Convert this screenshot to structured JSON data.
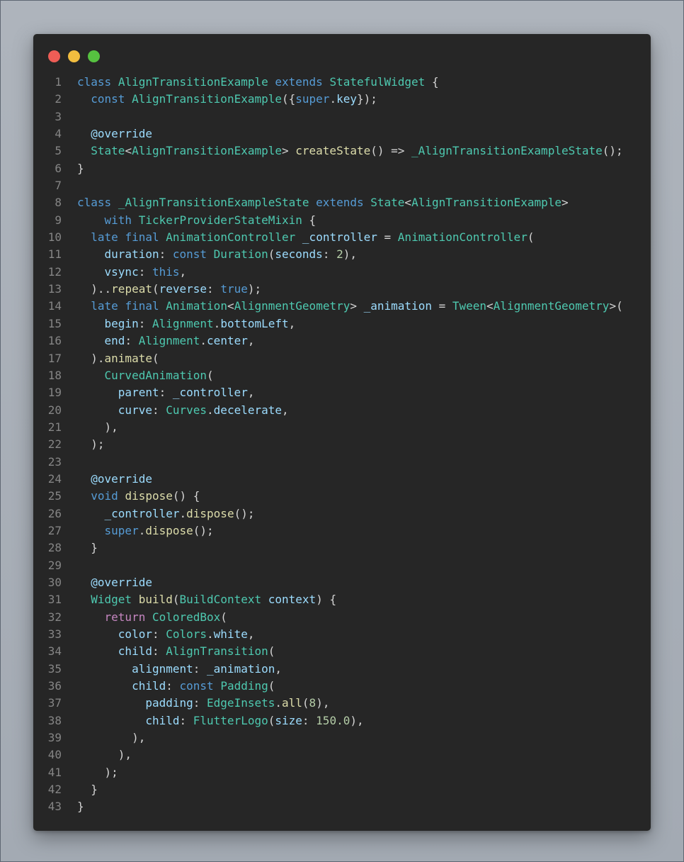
{
  "window": {
    "traffic_lights": [
      {
        "name": "close",
        "color": "#ee5d56"
      },
      {
        "name": "minimize",
        "color": "#f2bd3f"
      },
      {
        "name": "zoom",
        "color": "#56c140"
      }
    ]
  },
  "theme": {
    "background": "#262626",
    "line_number_color": "#858585",
    "keyword": "#569cd6",
    "control": "#c586c0",
    "type": "#4ec9b0",
    "function": "#dcdcaa",
    "variable": "#9cdcfe",
    "number": "#b5cea8",
    "plain": "#d4d4d4"
  },
  "code": {
    "language": "dart",
    "lines": [
      {
        "n": "1",
        "tokens": [
          [
            "kw",
            "class"
          ],
          [
            "pl",
            " "
          ],
          [
            "type",
            "AlignTransitionExample"
          ],
          [
            "pl",
            " "
          ],
          [
            "kw",
            "extends"
          ],
          [
            "pl",
            " "
          ],
          [
            "type",
            "StatefulWidget"
          ],
          [
            "pl",
            " {"
          ]
        ]
      },
      {
        "n": "2",
        "tokens": [
          [
            "pl",
            "  "
          ],
          [
            "kw",
            "const"
          ],
          [
            "pl",
            " "
          ],
          [
            "type",
            "AlignTransitionExample"
          ],
          [
            "pl",
            "({"
          ],
          [
            "kw",
            "super"
          ],
          [
            "pl",
            "."
          ],
          [
            "var",
            "key"
          ],
          [
            "pl",
            "});"
          ]
        ]
      },
      {
        "n": "3",
        "tokens": []
      },
      {
        "n": "4",
        "tokens": [
          [
            "pl",
            "  "
          ],
          [
            "an",
            "@override"
          ]
        ]
      },
      {
        "n": "5",
        "tokens": [
          [
            "pl",
            "  "
          ],
          [
            "type",
            "State"
          ],
          [
            "pl",
            "<"
          ],
          [
            "type",
            "AlignTransitionExample"
          ],
          [
            "pl",
            "> "
          ],
          [
            "fn",
            "createState"
          ],
          [
            "pl",
            "() => "
          ],
          [
            "type",
            "_AlignTransitionExampleState"
          ],
          [
            "pl",
            "();"
          ]
        ]
      },
      {
        "n": "6",
        "tokens": [
          [
            "pl",
            "}"
          ]
        ]
      },
      {
        "n": "7",
        "tokens": []
      },
      {
        "n": "8",
        "tokens": [
          [
            "kw",
            "class"
          ],
          [
            "pl",
            " "
          ],
          [
            "type",
            "_AlignTransitionExampleState"
          ],
          [
            "pl",
            " "
          ],
          [
            "kw",
            "extends"
          ],
          [
            "pl",
            " "
          ],
          [
            "type",
            "State"
          ],
          [
            "pl",
            "<"
          ],
          [
            "type",
            "AlignTransitionExample"
          ],
          [
            "pl",
            ">"
          ]
        ]
      },
      {
        "n": "9",
        "tokens": [
          [
            "pl",
            "    "
          ],
          [
            "kw",
            "with"
          ],
          [
            "pl",
            " "
          ],
          [
            "type",
            "TickerProviderStateMixin"
          ],
          [
            "pl",
            " {"
          ]
        ]
      },
      {
        "n": "10",
        "tokens": [
          [
            "pl",
            "  "
          ],
          [
            "kw",
            "late"
          ],
          [
            "pl",
            " "
          ],
          [
            "kw",
            "final"
          ],
          [
            "pl",
            " "
          ],
          [
            "type",
            "AnimationController"
          ],
          [
            "pl",
            " "
          ],
          [
            "var",
            "_controller"
          ],
          [
            "pl",
            " = "
          ],
          [
            "type",
            "AnimationController"
          ],
          [
            "pl",
            "("
          ]
        ]
      },
      {
        "n": "11",
        "tokens": [
          [
            "pl",
            "    "
          ],
          [
            "var",
            "duration"
          ],
          [
            "pl",
            ": "
          ],
          [
            "kw",
            "const"
          ],
          [
            "pl",
            " "
          ],
          [
            "type",
            "Duration"
          ],
          [
            "pl",
            "("
          ],
          [
            "var",
            "seconds"
          ],
          [
            "pl",
            ": "
          ],
          [
            "num",
            "2"
          ],
          [
            "pl",
            "),"
          ]
        ]
      },
      {
        "n": "12",
        "tokens": [
          [
            "pl",
            "    "
          ],
          [
            "var",
            "vsync"
          ],
          [
            "pl",
            ": "
          ],
          [
            "kw",
            "this"
          ],
          [
            "pl",
            ","
          ]
        ]
      },
      {
        "n": "13",
        "tokens": [
          [
            "pl",
            "  ).."
          ],
          [
            "fn",
            "repeat"
          ],
          [
            "pl",
            "("
          ],
          [
            "var",
            "reverse"
          ],
          [
            "pl",
            ": "
          ],
          [
            "kw",
            "true"
          ],
          [
            "pl",
            ");"
          ]
        ]
      },
      {
        "n": "14",
        "tokens": [
          [
            "pl",
            "  "
          ],
          [
            "kw",
            "late"
          ],
          [
            "pl",
            " "
          ],
          [
            "kw",
            "final"
          ],
          [
            "pl",
            " "
          ],
          [
            "type",
            "Animation"
          ],
          [
            "pl",
            "<"
          ],
          [
            "type",
            "AlignmentGeometry"
          ],
          [
            "pl",
            "> "
          ],
          [
            "var",
            "_animation"
          ],
          [
            "pl",
            " = "
          ],
          [
            "type",
            "Tween"
          ],
          [
            "pl",
            "<"
          ],
          [
            "type",
            "AlignmentGeometry"
          ],
          [
            "pl",
            ">("
          ]
        ]
      },
      {
        "n": "15",
        "tokens": [
          [
            "pl",
            "    "
          ],
          [
            "var",
            "begin"
          ],
          [
            "pl",
            ": "
          ],
          [
            "type",
            "Alignment"
          ],
          [
            "pl",
            "."
          ],
          [
            "var",
            "bottomLeft"
          ],
          [
            "pl",
            ","
          ]
        ]
      },
      {
        "n": "16",
        "tokens": [
          [
            "pl",
            "    "
          ],
          [
            "var",
            "end"
          ],
          [
            "pl",
            ": "
          ],
          [
            "type",
            "Alignment"
          ],
          [
            "pl",
            "."
          ],
          [
            "var",
            "center"
          ],
          [
            "pl",
            ","
          ]
        ]
      },
      {
        "n": "17",
        "tokens": [
          [
            "pl",
            "  )."
          ],
          [
            "fn",
            "animate"
          ],
          [
            "pl",
            "("
          ]
        ]
      },
      {
        "n": "18",
        "tokens": [
          [
            "pl",
            "    "
          ],
          [
            "type",
            "CurvedAnimation"
          ],
          [
            "pl",
            "("
          ]
        ]
      },
      {
        "n": "19",
        "tokens": [
          [
            "pl",
            "      "
          ],
          [
            "var",
            "parent"
          ],
          [
            "pl",
            ": "
          ],
          [
            "var",
            "_controller"
          ],
          [
            "pl",
            ","
          ]
        ]
      },
      {
        "n": "20",
        "tokens": [
          [
            "pl",
            "      "
          ],
          [
            "var",
            "curve"
          ],
          [
            "pl",
            ": "
          ],
          [
            "type",
            "Curves"
          ],
          [
            "pl",
            "."
          ],
          [
            "var",
            "decelerate"
          ],
          [
            "pl",
            ","
          ]
        ]
      },
      {
        "n": "21",
        "tokens": [
          [
            "pl",
            "    ),"
          ]
        ]
      },
      {
        "n": "22",
        "tokens": [
          [
            "pl",
            "  );"
          ]
        ]
      },
      {
        "n": "23",
        "tokens": []
      },
      {
        "n": "24",
        "tokens": [
          [
            "pl",
            "  "
          ],
          [
            "an",
            "@override"
          ]
        ]
      },
      {
        "n": "25",
        "tokens": [
          [
            "pl",
            "  "
          ],
          [
            "kw",
            "void"
          ],
          [
            "pl",
            " "
          ],
          [
            "fn",
            "dispose"
          ],
          [
            "pl",
            "() {"
          ]
        ]
      },
      {
        "n": "26",
        "tokens": [
          [
            "pl",
            "    "
          ],
          [
            "var",
            "_controller"
          ],
          [
            "pl",
            "."
          ],
          [
            "fn",
            "dispose"
          ],
          [
            "pl",
            "();"
          ]
        ]
      },
      {
        "n": "27",
        "tokens": [
          [
            "pl",
            "    "
          ],
          [
            "kw",
            "super"
          ],
          [
            "pl",
            "."
          ],
          [
            "fn",
            "dispose"
          ],
          [
            "pl",
            "();"
          ]
        ]
      },
      {
        "n": "28",
        "tokens": [
          [
            "pl",
            "  }"
          ]
        ]
      },
      {
        "n": "29",
        "tokens": []
      },
      {
        "n": "30",
        "tokens": [
          [
            "pl",
            "  "
          ],
          [
            "an",
            "@override"
          ]
        ]
      },
      {
        "n": "31",
        "tokens": [
          [
            "pl",
            "  "
          ],
          [
            "type",
            "Widget"
          ],
          [
            "pl",
            " "
          ],
          [
            "fn",
            "build"
          ],
          [
            "pl",
            "("
          ],
          [
            "type",
            "BuildContext"
          ],
          [
            "pl",
            " "
          ],
          [
            "var",
            "context"
          ],
          [
            "pl",
            ") {"
          ]
        ]
      },
      {
        "n": "32",
        "tokens": [
          [
            "pl",
            "    "
          ],
          [
            "ctl",
            "return"
          ],
          [
            "pl",
            " "
          ],
          [
            "type",
            "ColoredBox"
          ],
          [
            "pl",
            "("
          ]
        ]
      },
      {
        "n": "33",
        "tokens": [
          [
            "pl",
            "      "
          ],
          [
            "var",
            "color"
          ],
          [
            "pl",
            ": "
          ],
          [
            "type",
            "Colors"
          ],
          [
            "pl",
            "."
          ],
          [
            "var",
            "white"
          ],
          [
            "pl",
            ","
          ]
        ]
      },
      {
        "n": "34",
        "tokens": [
          [
            "pl",
            "      "
          ],
          [
            "var",
            "child"
          ],
          [
            "pl",
            ": "
          ],
          [
            "type",
            "AlignTransition"
          ],
          [
            "pl",
            "("
          ]
        ]
      },
      {
        "n": "35",
        "tokens": [
          [
            "pl",
            "        "
          ],
          [
            "var",
            "alignment"
          ],
          [
            "pl",
            ": "
          ],
          [
            "var",
            "_animation"
          ],
          [
            "pl",
            ","
          ]
        ]
      },
      {
        "n": "36",
        "tokens": [
          [
            "pl",
            "        "
          ],
          [
            "var",
            "child"
          ],
          [
            "pl",
            ": "
          ],
          [
            "kw",
            "const"
          ],
          [
            "pl",
            " "
          ],
          [
            "type",
            "Padding"
          ],
          [
            "pl",
            "("
          ]
        ]
      },
      {
        "n": "37",
        "tokens": [
          [
            "pl",
            "          "
          ],
          [
            "var",
            "padding"
          ],
          [
            "pl",
            ": "
          ],
          [
            "type",
            "EdgeInsets"
          ],
          [
            "pl",
            "."
          ],
          [
            "fn",
            "all"
          ],
          [
            "pl",
            "("
          ],
          [
            "num",
            "8"
          ],
          [
            "pl",
            "),"
          ]
        ]
      },
      {
        "n": "38",
        "tokens": [
          [
            "pl",
            "          "
          ],
          [
            "var",
            "child"
          ],
          [
            "pl",
            ": "
          ],
          [
            "type",
            "FlutterLogo"
          ],
          [
            "pl",
            "("
          ],
          [
            "var",
            "size"
          ],
          [
            "pl",
            ": "
          ],
          [
            "num",
            "150.0"
          ],
          [
            "pl",
            "),"
          ]
        ]
      },
      {
        "n": "39",
        "tokens": [
          [
            "pl",
            "        ),"
          ]
        ]
      },
      {
        "n": "40",
        "tokens": [
          [
            "pl",
            "      ),"
          ]
        ]
      },
      {
        "n": "41",
        "tokens": [
          [
            "pl",
            "    );"
          ]
        ]
      },
      {
        "n": "42",
        "tokens": [
          [
            "pl",
            "  }"
          ]
        ]
      },
      {
        "n": "43",
        "tokens": [
          [
            "pl",
            "}"
          ]
        ]
      }
    ]
  }
}
